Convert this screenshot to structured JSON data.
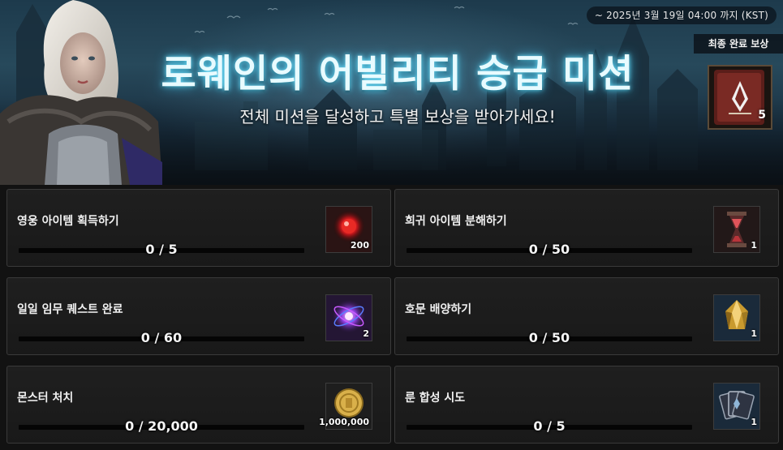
{
  "banner": {
    "date": "~ 2025년 3월 19일 04:00 까지 (KST)",
    "title": "로웨인의 어빌리티 승급 미션",
    "subtitle": "전체 미션을 달성하고 특별 보상을 받아가세요!",
    "final_reward": {
      "label": "최종 완료 보상",
      "icon": "ability-book-icon",
      "quantity": "5"
    }
  },
  "missions": [
    {
      "name": "영웅 아이템 획득하기",
      "progress_text": "0 / 5",
      "progress": 0,
      "reward_icon": "red-orb-icon",
      "reward_quantity": "200"
    },
    {
      "name": "희귀 아이템 분해하기",
      "progress_text": "0 / 50",
      "progress": 0,
      "reward_icon": "hourglass-icon",
      "reward_quantity": "1"
    },
    {
      "name": "일일 임무 퀘스트 완료",
      "progress_text": "0 / 60",
      "progress": 0,
      "reward_icon": "purple-orb-icon",
      "reward_quantity": "2"
    },
    {
      "name": "호문 배양하기",
      "progress_text": "0 / 50",
      "progress": 0,
      "reward_icon": "gold-crystal-icon",
      "reward_quantity": "1"
    },
    {
      "name": "몬스터 처치",
      "progress_text": "0 / 20,000",
      "progress": 0,
      "reward_icon": "gold-coin-icon",
      "reward_quantity": "1,000,000"
    },
    {
      "name": "룬 합성 시도",
      "progress_text": "0 / 5",
      "progress": 0,
      "reward_icon": "rune-cards-icon",
      "reward_quantity": "1"
    }
  ],
  "colors": {
    "accent": "#c8a45a",
    "title_glow": "#6fe4ff",
    "card_bg": "#1d1d1d",
    "card_border": "#3a3a3a"
  }
}
